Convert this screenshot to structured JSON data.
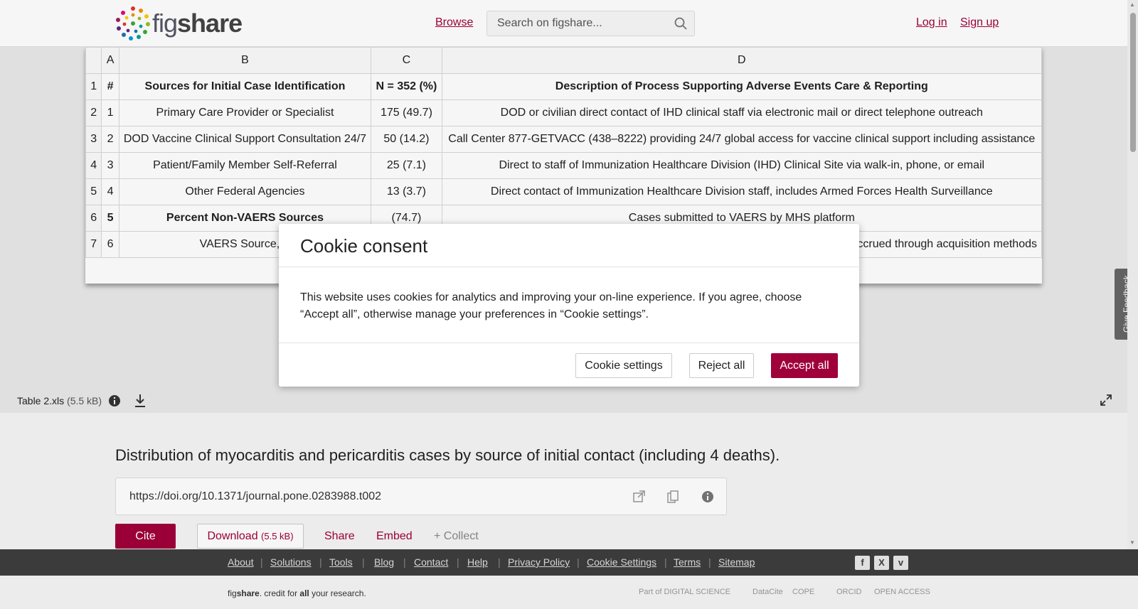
{
  "header": {
    "logo_text_light": "fig",
    "logo_text_bold": "share",
    "browse": "Browse",
    "search_placeholder": "Search on figshare...",
    "login": "Log in",
    "signup": "Sign up"
  },
  "spreadsheet": {
    "column_headers": [
      "",
      "A",
      "B",
      "C",
      "D"
    ],
    "rows": [
      {
        "n": "1",
        "a": "#",
        "b": "Sources for Initial Case Identification",
        "c": "N = 352 (%)",
        "d": "Description of Process Supporting Adverse Events Care & Reporting"
      },
      {
        "n": "2",
        "a": "1",
        "b": "Primary Care Provider or Specialist",
        "c": "175 (49.7)",
        "d": "DOD or civilian direct contact of IHD clinical staff via electronic mail or direct telephone outreach"
      },
      {
        "n": "3",
        "a": "2",
        "b": "DOD Vaccine Clinical Support Consultation 24/7",
        "c": "50 (14.2)",
        "d": "Call Center 877-GETVACC (438–8222) providing 24/7 global access for vaccine clinical support including assistance"
      },
      {
        "n": "4",
        "a": "3",
        "b": "Patient/Family Member Self-Referral",
        "c": "25 (7.1)",
        "d": "Direct to staff of Immunization Healthcare Division (IHD) Clinical Site via walk-in, phone, or email"
      },
      {
        "n": "5",
        "a": "4",
        "b": "Other Federal Agencies",
        "c": "13 (3.7)",
        "d": "Direct contact of Immunization Healthcare Division staff, includes Armed Forces Health Surveillance"
      },
      {
        "n": "6",
        "a": "5",
        "b": "Percent Non-VAERS Sources",
        "c": "(74.7)",
        "d": "Cases submitted to VAERS by MHS platform"
      },
      {
        "n": "7",
        "a": "6",
        "b": "VAERS Source, P",
        "c": "",
        "d": "ot accrued through acquisition methods"
      }
    ]
  },
  "feedback_tab": "Give Feedback",
  "file": {
    "name": "Table 2.xls",
    "size": "(5.5 kB)"
  },
  "item": {
    "title": "Distribution of myocarditis and pericarditis cases by source of initial contact (including 4 deaths).",
    "doi": "https://doi.org/10.1371/journal.pone.0283988.t002"
  },
  "actions": {
    "cite": "Cite",
    "download": "Download",
    "download_size": "(5.5 kB)",
    "share": "Share",
    "embed": "Embed",
    "collect": "+ Collect"
  },
  "footer": {
    "links": [
      "About",
      "Solutions",
      "Tools",
      "Blog",
      "Contact",
      "Help",
      "Privacy Policy",
      "Cookie Settings",
      "Terms",
      "Sitemap"
    ],
    "social": [
      "facebook-icon",
      "x-icon",
      "vimeo-icon"
    ],
    "tagline_light": "fig",
    "tagline_bold": "share",
    "tagline_rest_1": ". credit for ",
    "tagline_all": "all",
    "tagline_rest_2": " your research.",
    "partners": [
      "Part of DIGITAL SCIENCE",
      "DataCite",
      "COPE",
      "ORCID",
      "OPEN ACCESS"
    ]
  },
  "cookie_modal": {
    "title": "Cookie consent",
    "body": "This website uses cookies for analytics and improving your on-line experience. If you agree, choose “Accept all”, otherwise manage your preferences in “Cookie settings”.",
    "settings_button": "Cookie settings",
    "reject_button": "Reject all",
    "accept_button": "Accept all"
  },
  "colors": {
    "brand": "#a0003a",
    "footer_bg": "#3e3e3e"
  }
}
